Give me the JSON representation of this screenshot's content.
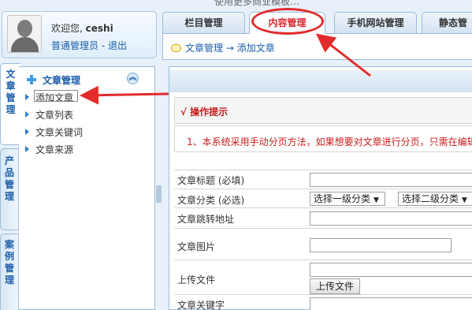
{
  "top_cut_text": "使用更多商业模板…",
  "user": {
    "welcome": "欢迎您,",
    "username": "ceshi",
    "role": "普通管理员",
    "separator": " - ",
    "logout": "退出"
  },
  "tabs": [
    {
      "label": "栏目管理",
      "active": false
    },
    {
      "label": "内容管理",
      "active": true
    },
    {
      "label": "手机网站管理",
      "active": false
    },
    {
      "label": "静态管",
      "active": false
    }
  ],
  "breadcrumb": {
    "section": "文章管理",
    "arrow": "→",
    "page": "添加文章"
  },
  "side_tabs": [
    {
      "label": "文章管理",
      "active": true
    },
    {
      "label": "产品管理",
      "active": false
    },
    {
      "label": "案例管理",
      "active": false
    }
  ],
  "left_nav": {
    "title": "文章管理",
    "collapse_glyph": "︽",
    "items": [
      {
        "label": "添加文章",
        "active": true
      },
      {
        "label": "文章列表",
        "active": false
      },
      {
        "label": "文章关键词",
        "active": false
      },
      {
        "label": "文章来源",
        "active": false
      }
    ]
  },
  "main": {
    "tip_title": "√ 操作提示",
    "tip_body": "1、本系统采用手动分页方法，如果想要对文章进行分页，只需在编辑",
    "form": {
      "title_label": "文章标题 (必填)",
      "category_label": "文章分类 (必选)",
      "category_level1": "选择一级分类",
      "category_level2": "选择二级分类",
      "redirect_label": "文章跳转地址",
      "image_label": "文章图片",
      "upload_label": "上传文件",
      "upload_button": "上传文件",
      "keywords_label": "文章关键字"
    }
  },
  "accent": {
    "annotation_red": "#e32b2b",
    "link_blue": "#1a5da8",
    "tip_red": "#c91c1c"
  }
}
